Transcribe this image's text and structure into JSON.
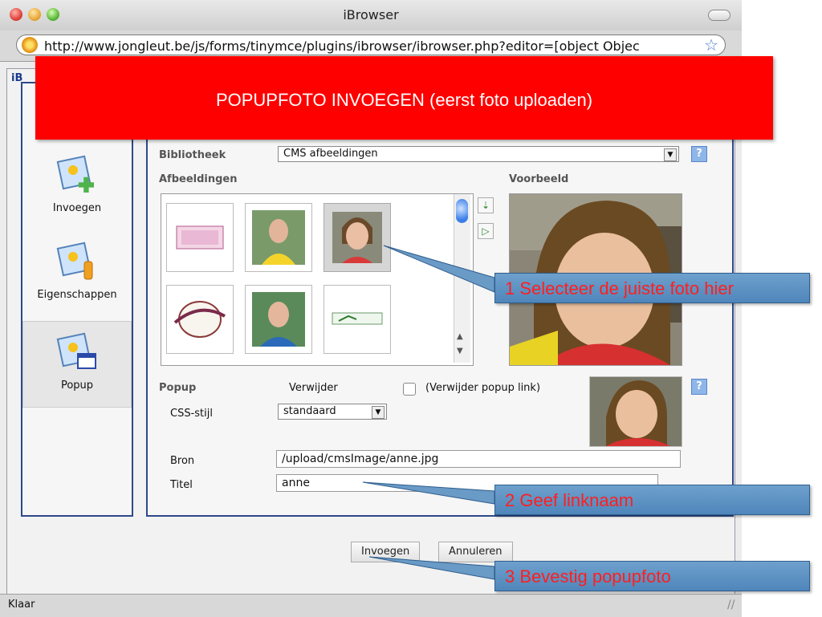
{
  "window": {
    "title": "iBrowser",
    "url": "http://www.jongleut.be/js/forms/tinymce/plugins/ibrowser/ibrowser.php?editor=[object Objec",
    "status": "Klaar"
  },
  "banner": {
    "text": "POPUPFOTO INVOEGEN (eerst foto uploaden)",
    "color": "#ff0000"
  },
  "tab": {
    "label": "iB"
  },
  "sidebar": {
    "items": [
      {
        "label": "Invoegen",
        "icon": "insert-image-icon"
      },
      {
        "label": "Eigenschappen",
        "icon": "image-properties-icon"
      },
      {
        "label": "Popup",
        "icon": "popup-image-icon"
      }
    ]
  },
  "form": {
    "library_label": "Bibliotheek",
    "library_value": "CMS afbeeldingen",
    "images_label": "Afbeeldingen",
    "preview_label": "Voorbeeld",
    "popup_label": "Popup",
    "remove_label": "Verwijder",
    "remove_checkbox_label": "(Verwijder popup link)",
    "css_label": "CSS-stijl",
    "css_value": "standaard",
    "source_label": "Bron",
    "source_value": "/upload/cmsImage/anne.jpg",
    "title_label": "Titel",
    "title_value": "anne"
  },
  "buttons": {
    "insert": "Invoegen",
    "cancel": "Annuleren"
  },
  "callouts": {
    "step1": "1 Selecteer de juiste foto hier",
    "step2": "2 Geef linknaam",
    "step3": "3 Bevestig popupfoto",
    "text_color": "#ff1f1f",
    "box_color": "#5b8fc2"
  }
}
